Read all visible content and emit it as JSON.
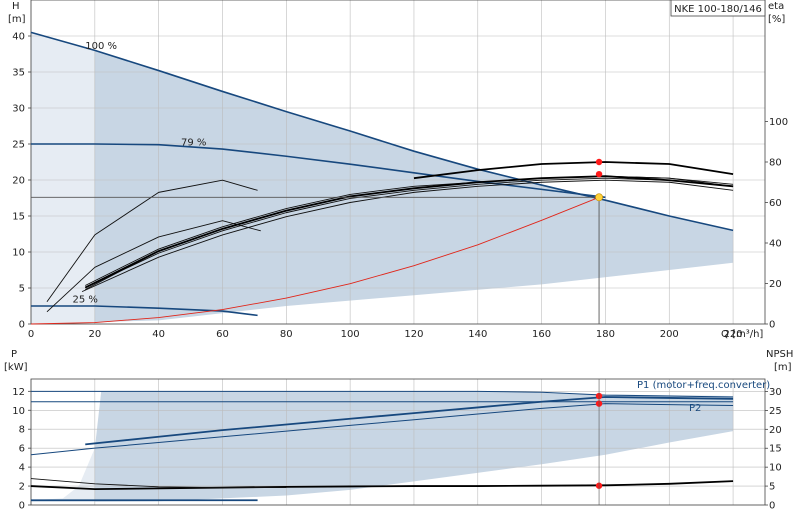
{
  "chart_data": [
    {
      "type": "line",
      "title": "NKE 100-180/146",
      "x_axis": {
        "label": "Q [m³/h]",
        "range": [
          0,
          230
        ],
        "ticks": [
          0,
          20,
          40,
          60,
          80,
          100,
          120,
          140,
          160,
          180,
          200,
          220
        ]
      },
      "y_axis_left": {
        "label_top": "H",
        "label_unit": "[m]",
        "range": [
          0,
          45
        ],
        "ticks": [
          0,
          5,
          10,
          15,
          20,
          25,
          30,
          35,
          40
        ]
      },
      "y_axis_right": {
        "label_top": "eta",
        "label_unit": "[%]",
        "range": [
          0,
          160
        ],
        "ticks": [
          0,
          20,
          40,
          60,
          80,
          100
        ]
      },
      "grid": true,
      "operating_region": [
        [
          0,
          40.5
        ],
        [
          0,
          0
        ],
        [
          40,
          0.5
        ],
        [
          80,
          2.5
        ],
        [
          120,
          4
        ],
        [
          160,
          5.5
        ],
        [
          200,
          7.5
        ],
        [
          220,
          8.5
        ],
        [
          220,
          13
        ],
        [
          200,
          15
        ],
        [
          180,
          17.2
        ],
        [
          160,
          19.3
        ],
        [
          140,
          21.5
        ],
        [
          120,
          24
        ],
        [
          100,
          26.8
        ],
        [
          80,
          29.5
        ],
        [
          60,
          32.3
        ],
        [
          40,
          35.2
        ],
        [
          20,
          38
        ],
        [
          0,
          40.5
        ]
      ],
      "series": [
        {
          "name": "100 %",
          "kind": "head",
          "x": [
            0,
            20,
            40,
            60,
            80,
            100,
            120,
            140,
            160,
            180,
            200,
            220
          ],
          "y": [
            40.5,
            38,
            35.2,
            32.3,
            29.5,
            26.8,
            24,
            21.5,
            19.3,
            17.2,
            15,
            13
          ]
        },
        {
          "name": "79 %",
          "kind": "head",
          "x": [
            0,
            20,
            40,
            60,
            80,
            100,
            120,
            140,
            160,
            180
          ],
          "y": [
            25,
            25,
            24.9,
            24.3,
            23.3,
            22.2,
            21,
            19.8,
            18.7,
            17.6
          ]
        },
        {
          "name": "25 %",
          "kind": "head",
          "x": [
            0,
            20,
            40,
            60,
            71
          ],
          "y": [
            2.5,
            2.5,
            2.2,
            1.8,
            1.2
          ]
        },
        {
          "name": "",
          "kind": "system",
          "x": [
            0,
            20,
            40,
            60,
            80,
            100,
            120,
            140,
            160,
            178
          ],
          "y": [
            0,
            0.2,
            0.9,
            2.0,
            3.6,
            5.6,
            8.1,
            11.0,
            14.4,
            17.6
          ]
        },
        {
          "name": "",
          "kind": "efficiency",
          "x": [
            5,
            20,
            40,
            60,
            71
          ],
          "y": [
            11,
            44,
            65,
            71,
            66
          ]
        },
        {
          "name": "",
          "kind": "efficiency",
          "x": [
            5,
            20,
            40,
            60,
            72
          ],
          "y": [
            6,
            28,
            43,
            51,
            46
          ]
        },
        {
          "name": "",
          "kind": "efficiency",
          "x": [
            17,
            40,
            60,
            80,
            100,
            120,
            140,
            160,
            180,
            200,
            220
          ],
          "y": [
            18,
            35,
            46,
            55,
            62,
            66,
            69,
            71,
            72,
            71,
            68
          ]
        },
        {
          "name": "",
          "kind": "efficiency",
          "x": [
            16,
            40,
            60,
            80,
            100,
            120,
            140,
            160,
            180,
            200,
            220
          ],
          "y": [
            16,
            33,
            44,
            53,
            60,
            65,
            68,
            70,
            71,
            70,
            66
          ]
        },
        {
          "name": "",
          "kind": "efficiency",
          "x": [
            17,
            40,
            60,
            80,
            100,
            120,
            140,
            160,
            180,
            200,
            220
          ],
          "y": [
            19,
            37,
            48,
            57,
            64,
            68,
            70,
            72,
            73,
            72,
            68
          ]
        },
        {
          "name": "",
          "kind": "efficiency",
          "x": [
            17,
            40,
            60,
            80,
            100,
            120,
            140,
            160,
            180,
            200,
            220
          ],
          "y": [
            17,
            36,
            47,
            56,
            63,
            67,
            70,
            72,
            73,
            72,
            69
          ]
        },
        {
          "name": "",
          "kind": "efficiency-bold",
          "x": [
            17,
            40,
            60,
            80,
            100,
            120,
            140,
            160,
            180,
            200,
            220
          ],
          "y": [
            18,
            36,
            47,
            56,
            63,
            67,
            70,
            72,
            73,
            71,
            68
          ]
        },
        {
          "name": "",
          "kind": "efficiency-bold",
          "x": [
            120,
            140,
            160,
            180,
            200,
            220
          ],
          "y": [
            72,
            76,
            79,
            80,
            79,
            74
          ]
        }
      ],
      "duty_point": {
        "x": 178,
        "y": 17.6
      },
      "markers": [
        {
          "x": 178,
          "eta": 80
        },
        {
          "x": 178,
          "eta": 74
        }
      ],
      "curve_labels": [
        "100 %",
        "79 %",
        "25 %"
      ]
    },
    {
      "type": "line",
      "x_axis": {
        "range": [
          0,
          230
        ]
      },
      "y_axis_left": {
        "label_top": "P",
        "label_unit": "[kW]",
        "range": [
          0,
          13.3
        ],
        "ticks": [
          0,
          2,
          4,
          6,
          8,
          10,
          12
        ]
      },
      "y_axis_right": {
        "label_top": "NPSH",
        "label_unit": "[m]",
        "range": [
          0,
          33.3
        ],
        "ticks": [
          0,
          5,
          10,
          15,
          20,
          25,
          30
        ]
      },
      "grid": true,
      "operating_region": [
        [
          0,
          0.5
        ],
        [
          10,
          0.7
        ],
        [
          15,
          2
        ],
        [
          20,
          6
        ],
        [
          22,
          12
        ],
        [
          150,
          12
        ],
        [
          170,
          11.7
        ],
        [
          220,
          11.5
        ],
        [
          220,
          7.8
        ],
        [
          200,
          6.6
        ],
        [
          180,
          5.3
        ],
        [
          160,
          4.3
        ],
        [
          120,
          2.5
        ],
        [
          100,
          1.6
        ],
        [
          80,
          1.0
        ],
        [
          40,
          0.4
        ],
        [
          0,
          0.3
        ]
      ],
      "series": [
        {
          "name": "P1 (motor+freq.converter)",
          "kind": "power",
          "x": [
            0,
            20,
            40,
            60,
            80,
            100,
            120,
            140,
            160,
            180,
            200,
            220
          ],
          "y": [
            12,
            12,
            12,
            12,
            12,
            12,
            12,
            12,
            11.9,
            11.6,
            11.5,
            11.4
          ]
        },
        {
          "name": "P2",
          "kind": "power",
          "x": [
            0,
            20,
            40,
            60,
            80,
            100,
            120,
            140,
            160,
            180,
            200,
            220
          ],
          "y": [
            10.9,
            10.9,
            10.9,
            10.9,
            10.9,
            10.9,
            10.9,
            10.9,
            10.9,
            10.9,
            10.9,
            10.9
          ]
        },
        {
          "name": "",
          "kind": "power-bold",
          "x": [
            17,
            40,
            60,
            80,
            100,
            120,
            140,
            160,
            180,
            200,
            220
          ],
          "y": [
            6.4,
            7.2,
            7.9,
            8.5,
            9.1,
            9.7,
            10.3,
            10.9,
            11.4,
            11.3,
            11.2
          ]
        },
        {
          "name": "",
          "kind": "power",
          "x": [
            0,
            20,
            40,
            60,
            80,
            100,
            120,
            140,
            160,
            180,
            200,
            220
          ],
          "y": [
            5.3,
            6.0,
            6.6,
            7.2,
            7.8,
            8.4,
            9.0,
            9.6,
            10.2,
            10.7,
            10.6,
            10.5
          ]
        },
        {
          "name": "",
          "kind": "npsh-bold",
          "x": [
            0,
            20,
            40,
            60,
            80,
            100,
            120,
            140,
            160,
            180,
            200,
            220
          ],
          "y": [
            5,
            4.2,
            4.4,
            4.6,
            4.8,
            4.9,
            5.0,
            5.0,
            5.1,
            5.2,
            5.6,
            6.3
          ]
        },
        {
          "name": "",
          "kind": "npsh",
          "x": [
            0,
            20,
            40,
            60,
            80
          ],
          "y": [
            7,
            5.6,
            4.8,
            4.6,
            4.6
          ]
        },
        {
          "name": "",
          "kind": "low-power",
          "x": [
            0,
            71
          ],
          "y": [
            0.5,
            0.5
          ]
        }
      ],
      "markers": [
        {
          "x": 178,
          "y": 11.5
        },
        {
          "x": 178,
          "y": 10.7
        },
        {
          "x": 178,
          "npsh": 5.1
        }
      ]
    }
  ]
}
